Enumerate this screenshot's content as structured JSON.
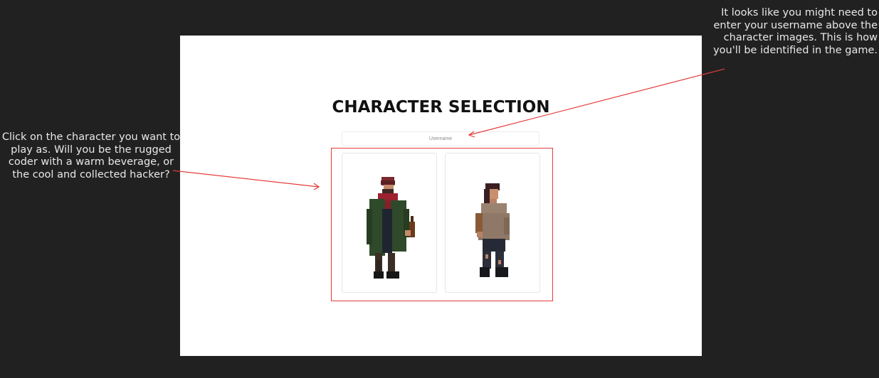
{
  "page": {
    "title": "CHARACTER SELECTION",
    "username_placeholder": "Username"
  },
  "characters": [
    {
      "id": "rugged-coder",
      "description": "rugged coder with a warm beverage"
    },
    {
      "id": "hacker",
      "description": "cool and collected hacker"
    }
  ],
  "annotations": {
    "left_note": "Click on the character you want to play as.  Will you be the rugged coder with a warm beverage, or the cool and collected hacker?",
    "right_note": "It looks like you might need to enter your username above the character images. This is how you'll be identified in the game."
  },
  "colors": {
    "background": "#212121",
    "panel": "#ffffff",
    "accent_red": "#e53b3b"
  }
}
